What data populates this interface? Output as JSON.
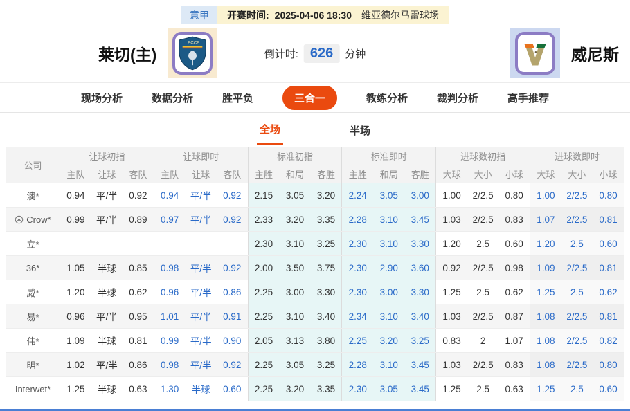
{
  "colors": {
    "accent": "#ea4a0f",
    "live_text": "#2a6ac8",
    "standard_tint": "#e7f6f6",
    "bottom_line": "#4a7fd4"
  },
  "match_bar": {
    "league": "意甲",
    "kickoff_label": "开赛时间:",
    "kickoff_time": "2025-04-06 18:30",
    "venue": "维亚德尔马雷球场"
  },
  "teams": {
    "home_name": "莱切(主)",
    "away_name": "威尼斯",
    "countdown_label": "倒计时:",
    "countdown_value": "626",
    "countdown_unit": "分钟"
  },
  "nav": [
    {
      "key": "live-analysis",
      "label": "现场分析",
      "active": false
    },
    {
      "key": "data-analysis",
      "label": "数据分析",
      "active": false
    },
    {
      "key": "win-draw-loss",
      "label": "胜平负",
      "active": false
    },
    {
      "key": "three-in-one",
      "label": "三合一",
      "active": true
    },
    {
      "key": "coach-analysis",
      "label": "教练分析",
      "active": false
    },
    {
      "key": "referee-analysis",
      "label": "裁判分析",
      "active": false
    },
    {
      "key": "expert-picks",
      "label": "高手推荐",
      "active": false
    }
  ],
  "subtabs": [
    {
      "key": "full-match",
      "label": "全场",
      "active": true
    },
    {
      "key": "half-match",
      "label": "半场",
      "active": false
    }
  ],
  "table": {
    "company_header": "公司",
    "groups": [
      {
        "key": "handicap-initial",
        "label": "让球初指",
        "cols": [
          "主队",
          "让球",
          "客队"
        ],
        "live": false,
        "tint": false,
        "shade": false
      },
      {
        "key": "handicap-live",
        "label": "让球即时",
        "cols": [
          "主队",
          "让球",
          "客队"
        ],
        "live": true,
        "tint": false,
        "shade": false
      },
      {
        "key": "standard-initial",
        "label": "标准初指",
        "cols": [
          "主胜",
          "和局",
          "客胜"
        ],
        "live": false,
        "tint": true,
        "shade": false
      },
      {
        "key": "standard-live",
        "label": "标准即时",
        "cols": [
          "主胜",
          "和局",
          "客胜"
        ],
        "live": true,
        "tint": true,
        "shade": false
      },
      {
        "key": "goals-initial",
        "label": "进球数初指",
        "cols": [
          "大球",
          "大小",
          "小球"
        ],
        "live": false,
        "tint": false,
        "shade": false
      },
      {
        "key": "goals-live",
        "label": "进球数即时",
        "cols": [
          "大球",
          "大小",
          "小球"
        ],
        "live": true,
        "tint": false,
        "shade": true
      }
    ],
    "rows": [
      {
        "company": "澳*",
        "ball_icon": false,
        "odds": [
          [
            "0.94",
            "平/半",
            "0.92"
          ],
          [
            "0.94",
            "平/半",
            "0.92"
          ],
          [
            "2.15",
            "3.05",
            "3.20"
          ],
          [
            "2.24",
            "3.05",
            "3.00"
          ],
          [
            "1.00",
            "2/2.5",
            "0.80"
          ],
          [
            "1.00",
            "2/2.5",
            "0.80"
          ]
        ]
      },
      {
        "company": "Crow*",
        "ball_icon": true,
        "odds": [
          [
            "0.99",
            "平/半",
            "0.89"
          ],
          [
            "0.97",
            "平/半",
            "0.92"
          ],
          [
            "2.33",
            "3.20",
            "3.35"
          ],
          [
            "2.28",
            "3.10",
            "3.45"
          ],
          [
            "1.03",
            "2/2.5",
            "0.83"
          ],
          [
            "1.07",
            "2/2.5",
            "0.81"
          ]
        ]
      },
      {
        "company": "立*",
        "ball_icon": false,
        "odds": [
          [
            "",
            "",
            ""
          ],
          [
            "",
            "",
            ""
          ],
          [
            "2.30",
            "3.10",
            "3.25"
          ],
          [
            "2.30",
            "3.10",
            "3.30"
          ],
          [
            "1.20",
            "2.5",
            "0.60"
          ],
          [
            "1.20",
            "2.5",
            "0.60"
          ]
        ]
      },
      {
        "company": "36*",
        "ball_icon": false,
        "odds": [
          [
            "1.05",
            "半球",
            "0.85"
          ],
          [
            "0.98",
            "平/半",
            "0.92"
          ],
          [
            "2.00",
            "3.50",
            "3.75"
          ],
          [
            "2.30",
            "2.90",
            "3.60"
          ],
          [
            "0.92",
            "2/2.5",
            "0.98"
          ],
          [
            "1.09",
            "2/2.5",
            "0.81"
          ]
        ]
      },
      {
        "company": "威*",
        "ball_icon": false,
        "odds": [
          [
            "1.20",
            "半球",
            "0.62"
          ],
          [
            "0.96",
            "平/半",
            "0.86"
          ],
          [
            "2.25",
            "3.00",
            "3.30"
          ],
          [
            "2.30",
            "3.00",
            "3.30"
          ],
          [
            "1.25",
            "2.5",
            "0.62"
          ],
          [
            "1.25",
            "2.5",
            "0.62"
          ]
        ]
      },
      {
        "company": "易*",
        "ball_icon": false,
        "odds": [
          [
            "0.96",
            "平/半",
            "0.95"
          ],
          [
            "1.01",
            "平/半",
            "0.91"
          ],
          [
            "2.25",
            "3.10",
            "3.40"
          ],
          [
            "2.34",
            "3.10",
            "3.40"
          ],
          [
            "1.03",
            "2/2.5",
            "0.87"
          ],
          [
            "1.08",
            "2/2.5",
            "0.81"
          ]
        ]
      },
      {
        "company": "伟*",
        "ball_icon": false,
        "odds": [
          [
            "1.09",
            "半球",
            "0.81"
          ],
          [
            "0.99",
            "平/半",
            "0.90"
          ],
          [
            "2.05",
            "3.13",
            "3.80"
          ],
          [
            "2.25",
            "3.20",
            "3.25"
          ],
          [
            "0.83",
            "2",
            "1.07"
          ],
          [
            "1.08",
            "2/2.5",
            "0.82"
          ]
        ]
      },
      {
        "company": "明*",
        "ball_icon": false,
        "odds": [
          [
            "1.02",
            "平/半",
            "0.86"
          ],
          [
            "0.98",
            "平/半",
            "0.92"
          ],
          [
            "2.25",
            "3.05",
            "3.25"
          ],
          [
            "2.28",
            "3.10",
            "3.45"
          ],
          [
            "1.03",
            "2/2.5",
            "0.83"
          ],
          [
            "1.08",
            "2/2.5",
            "0.80"
          ]
        ]
      },
      {
        "company": "Interwet*",
        "ball_icon": false,
        "odds": [
          [
            "1.25",
            "半球",
            "0.63"
          ],
          [
            "1.30",
            "半球",
            "0.60"
          ],
          [
            "2.25",
            "3.20",
            "3.35"
          ],
          [
            "2.30",
            "3.05",
            "3.45"
          ],
          [
            "1.25",
            "2.5",
            "0.63"
          ],
          [
            "1.25",
            "2.5",
            "0.60"
          ]
        ]
      }
    ]
  }
}
